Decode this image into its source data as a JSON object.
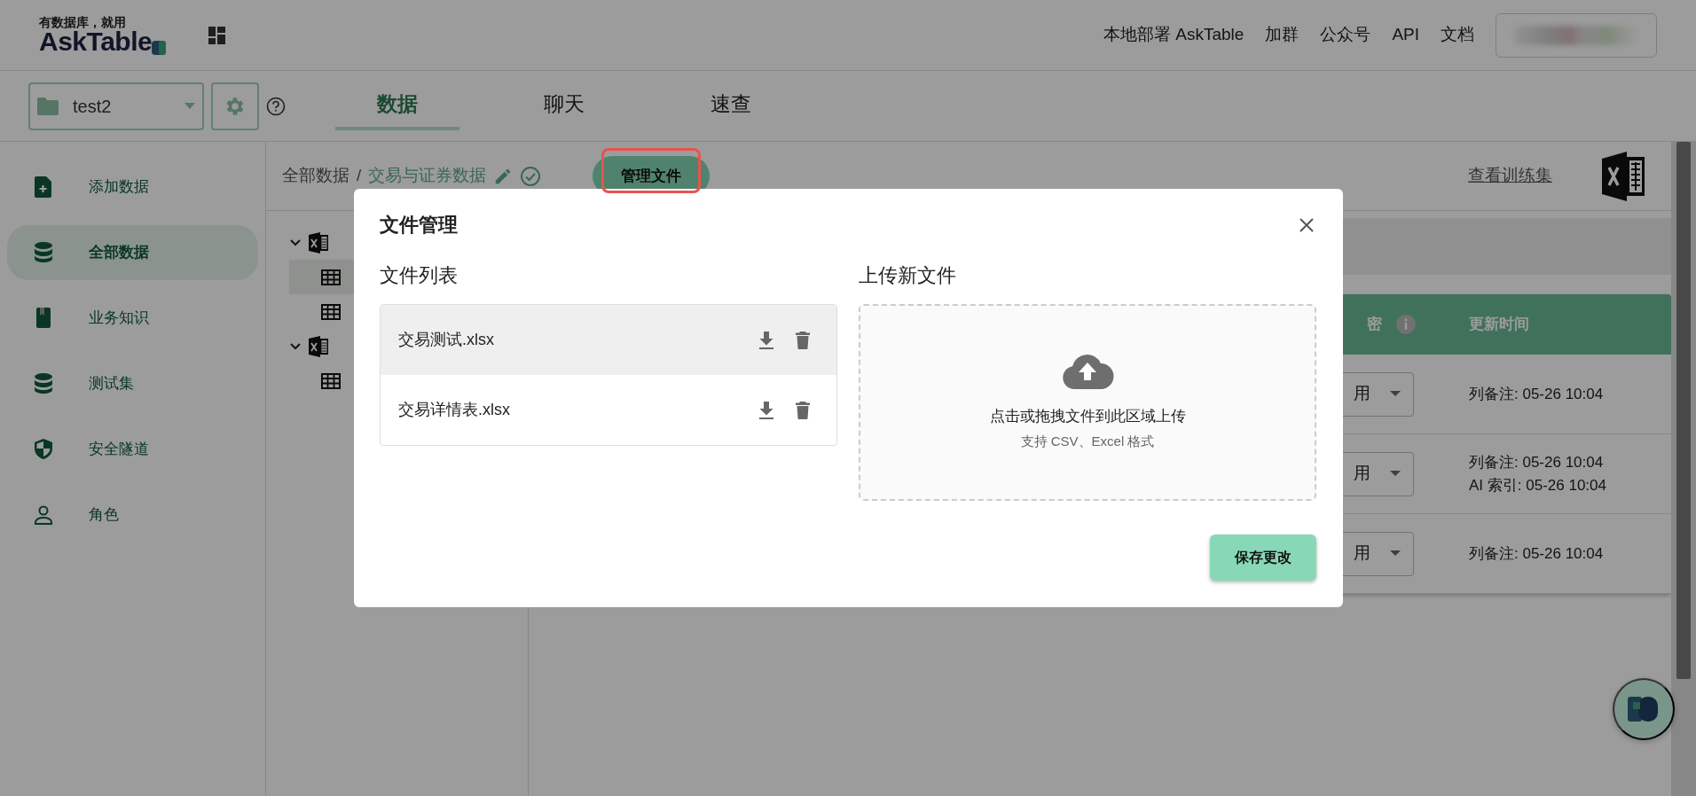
{
  "header": {
    "logo_tagline": "有数据库，就用",
    "logo_text": "AskTable",
    "nav_links": [
      "本地部署 AskTable",
      "加群",
      "公众号",
      "API",
      "文档"
    ]
  },
  "toolbar": {
    "project": "test2",
    "tabs": [
      {
        "label": "数据",
        "selected": true
      },
      {
        "label": "聊天",
        "selected": false
      },
      {
        "label": "速查",
        "selected": false
      }
    ]
  },
  "sidebar": {
    "items": [
      {
        "label": "添加数据",
        "selected": false
      },
      {
        "label": "全部数据",
        "selected": true
      },
      {
        "label": "业务知识",
        "selected": false
      },
      {
        "label": "测试集",
        "selected": false
      },
      {
        "label": "安全隧道",
        "selected": false
      },
      {
        "label": "角色",
        "selected": false
      }
    ]
  },
  "breadcrumb": {
    "items": [
      "全部数据",
      "交易与证券数据"
    ],
    "separator": "/",
    "manage_button": "管理文件",
    "training_link": "查看训练集"
  },
  "tree": [
    {
      "expanded": true,
      "children": [
        {
          "selected": true
        },
        {
          "selected": false
        }
      ]
    },
    {
      "expanded": true,
      "children": [
        {
          "selected": false
        }
      ]
    }
  ],
  "table": {
    "columns": [
      "密",
      "更新时间"
    ],
    "rows": [
      {
        "column_1": "用",
        "updates": [
          "列备注: 05-26 10:04"
        ]
      },
      {
        "column_1": "用",
        "updates": [
          "列备注: 05-26 10:04",
          "AI 索引: 05-26 10:04"
        ]
      },
      {
        "column_1": "用",
        "updates": [
          "列备注: 05-26 10:04"
        ]
      }
    ]
  },
  "modal": {
    "title": "文件管理",
    "list_heading": "文件列表",
    "files": [
      {
        "name": "交易测试.xlsx",
        "highlighted": true
      },
      {
        "name": "交易详情表.xlsx",
        "highlighted": false
      }
    ],
    "upload_heading": "上传新文件",
    "dropzone_text": "点击或拖拽文件到此区域上传",
    "dropzone_hint": "支持 CSV、Excel 格式",
    "save_button": "保存更改"
  }
}
